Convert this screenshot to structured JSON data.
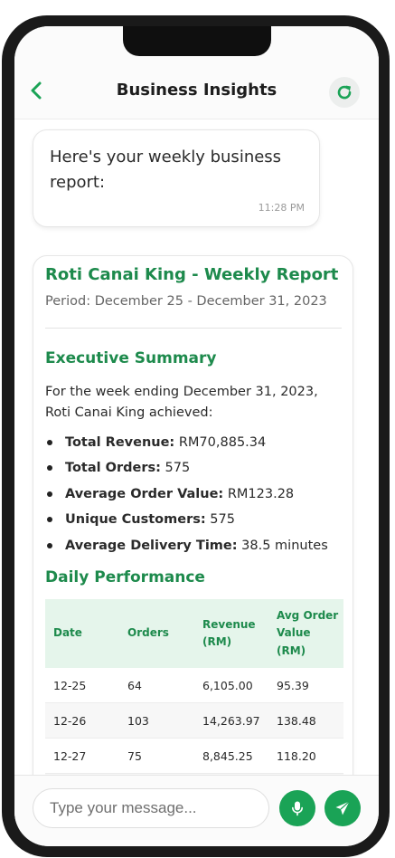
{
  "header": {
    "title": "Business Insights"
  },
  "message": {
    "text": "Here's your weekly business report:",
    "time": "11:28 PM"
  },
  "report": {
    "title": "Roti Canai King - Weekly Report",
    "period": "Period: December 25 - December 31, 2023",
    "summary_heading": "Executive Summary",
    "summary_intro": "For the week ending December 31, 2023, Roti Canai King achieved:",
    "metrics": [
      {
        "label": "Total Revenue:",
        "value": "RM70,885.34"
      },
      {
        "label": "Total Orders:",
        "value": "575"
      },
      {
        "label": "Average Order Value:",
        "value": "RM123.28"
      },
      {
        "label": "Unique Customers:",
        "value": "575"
      },
      {
        "label": "Average Delivery Time:",
        "value": "38.5 minutes"
      }
    ],
    "daily_heading": "Daily Performance",
    "table": {
      "headers": [
        "Date",
        "Orders",
        "Revenue (RM)",
        "Avg Order Value (RM)"
      ],
      "rows": [
        [
          "12-25",
          "64",
          "6,105.00",
          "95.39"
        ],
        [
          "12-26",
          "103",
          "14,263.97",
          "138.48"
        ],
        [
          "12-27",
          "75",
          "8,845.25",
          "118.20"
        ]
      ]
    }
  },
  "composer": {
    "placeholder": "Type your message..."
  },
  "colors": {
    "accent": "#1d8a4c",
    "button": "#1aa356",
    "table_header_bg": "#e5f5eb"
  },
  "icons": {
    "back": "chevron-left-icon",
    "refresh": "refresh-icon",
    "mic": "microphone-icon",
    "send": "send-icon"
  }
}
